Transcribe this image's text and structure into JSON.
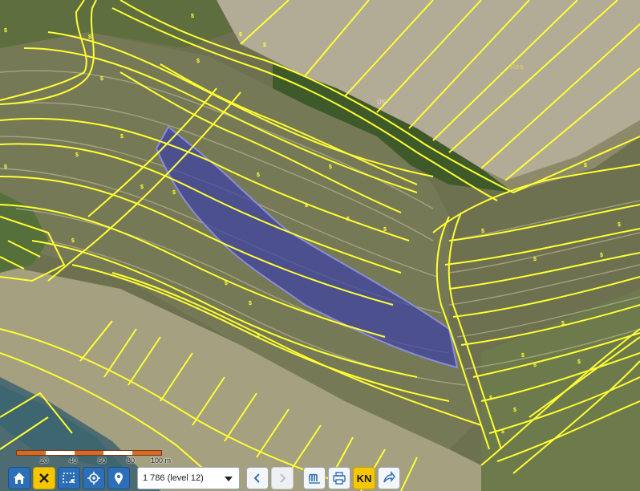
{
  "map": {
    "parcel_label": "Réa",
    "road_label": "ÚS",
    "parcel_marker": "$"
  },
  "scalebar": {
    "ticks": [
      "20",
      "40",
      "60",
      "80",
      "100 m"
    ]
  },
  "toolbar": {
    "scale_value": "1 786 (level 12)",
    "cadastre_label": "KN"
  },
  "colors": {
    "parcel_lines": "#ffff33",
    "selected_parcel": "#3b3fa8",
    "toolbar_blue": "#2d6fb6",
    "toolbar_yellow": "#f6c700",
    "scale_bar": "#d5692a"
  },
  "icons": [
    "home-icon",
    "close-icon",
    "select-rectangle-icon",
    "locate-icon",
    "pin-icon",
    "chevron-down-icon",
    "chevron-left-icon",
    "chevron-right-icon",
    "measure-icon",
    "print-icon",
    "share-icon"
  ]
}
